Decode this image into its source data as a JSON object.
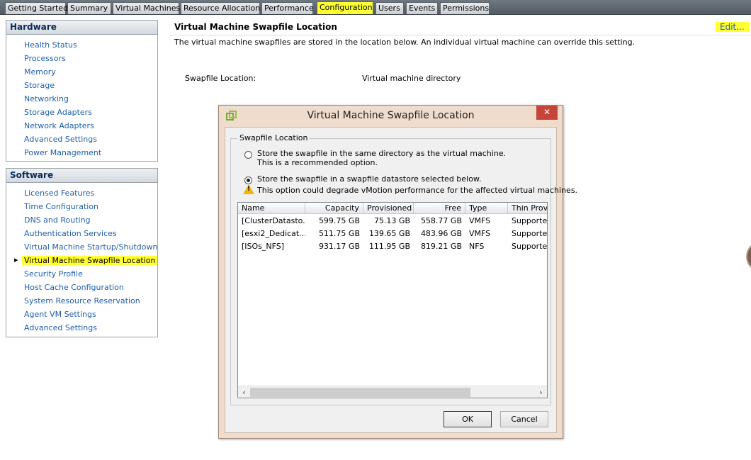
{
  "tabs": [
    {
      "label": "Getting Started",
      "active": false
    },
    {
      "label": "Summary",
      "active": false
    },
    {
      "label": "Virtual Machines",
      "active": false
    },
    {
      "label": "Resource Allocation",
      "active": false
    },
    {
      "label": "Performance",
      "active": false
    },
    {
      "label": "Configuration",
      "active": true
    },
    {
      "label": "Users",
      "active": false
    },
    {
      "label": "Events",
      "active": false
    },
    {
      "label": "Permissions",
      "active": false
    }
  ],
  "hardware": {
    "heading": "Hardware",
    "items": [
      "Health Status",
      "Processors",
      "Memory",
      "Storage",
      "Networking",
      "Storage Adapters",
      "Network Adapters",
      "Advanced Settings",
      "Power Management"
    ]
  },
  "software": {
    "heading": "Software",
    "items": [
      "Licensed Features",
      "Time Configuration",
      "DNS and Routing",
      "Authentication Services",
      "Virtual Machine Startup/Shutdown",
      "Virtual Machine Swapfile Location",
      "Security Profile",
      "Host Cache Configuration",
      "System Resource Reservation",
      "Agent VM Settings",
      "Advanced Settings"
    ],
    "selected": "Virtual Machine Swapfile Location"
  },
  "main": {
    "title": "Virtual Machine Swapfile Location",
    "edit_link": "Edit...",
    "description": "The virtual machine swapfiles are stored in the location below. An individual virtual machine can override this setting.",
    "swapfile_label": "Swapfile Location:",
    "swapfile_value": "Virtual machine directory"
  },
  "dialog": {
    "title": "Virtual Machine Swapfile Location",
    "close_glyph": "✕",
    "group_label": "Swapfile Location",
    "option1_line1": "Store the swapfile in the same directory as the virtual machine.",
    "option1_line2": "This is a recommended option.",
    "option2_line1": "Store the swapfile in a swapfile datastore selected below.",
    "option2_warning": "This option could degrade vMotion performance for the affected virtual machines.",
    "selected_option": 2,
    "columns": [
      "Name",
      "Capacity",
      "Provisioned",
      "Free",
      "Type",
      "Thin Provi"
    ],
    "rows": [
      [
        "[ClusterDatasto...",
        "599.75 GB",
        "75.13 GB",
        "558.77 GB",
        "VMFS",
        "Supported"
      ],
      [
        "[esxi2_Dedicat...",
        "511.75 GB",
        "139.65 GB",
        "483.96 GB",
        "VMFS",
        "Supported"
      ],
      [
        "[ISOs_NFS]",
        "931.17 GB",
        "111.95 GB",
        "819.21 GB",
        "NFS",
        "Supported"
      ]
    ],
    "ok_label": "OK",
    "cancel_label": "Cancel"
  },
  "colors": {
    "highlight": "#ffff33",
    "link": "#1f5fad",
    "close_button": "#c7443a"
  },
  "icons": {
    "dialog_icon": "vsphere-app-icon",
    "warning_icon": "warning-triangle-icon",
    "nav_pointer": "nav-arrow-icon",
    "scroll_left": "scroll-left-icon",
    "scroll_right": "scroll-right-icon"
  }
}
